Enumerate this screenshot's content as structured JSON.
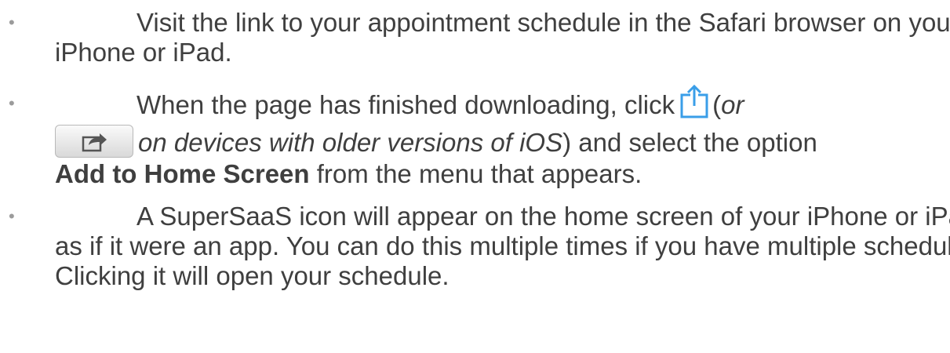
{
  "steps": [
    {
      "text": "Visit the link to your appointment schedule in the Safari browser on your iPhone or iPad."
    },
    {
      "part1": "When the page has finished downloading, click",
      "paren_open": "(",
      "or": "or",
      "older_ios": "on devices with older versions of iOS",
      "paren_close": ")",
      "and_select": "and select the option",
      "option": "Add to Home Screen",
      "from_menu": "from the menu that appears."
    },
    {
      "text": "A SuperSaaS icon will appear on the home screen of your iPhone or iPad, as if it were an app. You can do this multiple times if you have multiple schedules. Clicking it will open your schedule."
    }
  ],
  "bullet_char": "•",
  "icons": {
    "share_new": "share-icon",
    "share_old": "share-button-icon"
  },
  "colors": {
    "text": "#3f3f3f",
    "bullet": "#9b9b9b",
    "share_icon": "#3a9ee8"
  }
}
